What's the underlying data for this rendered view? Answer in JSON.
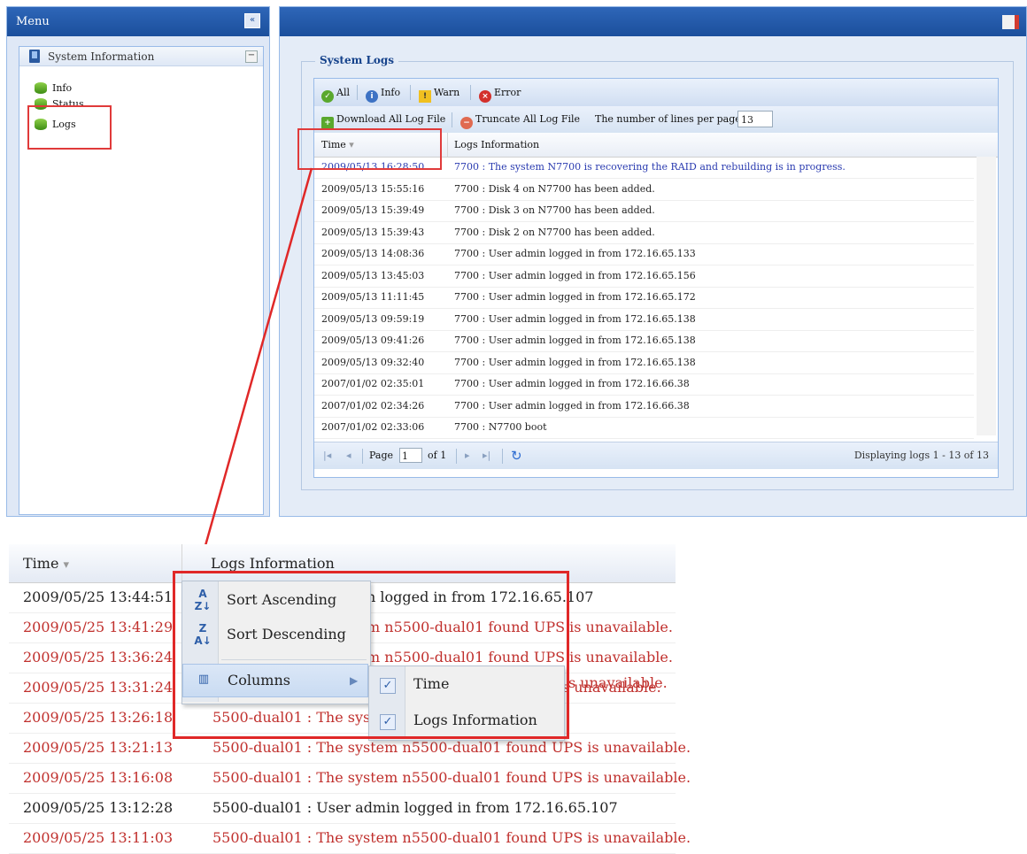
{
  "menu": {
    "title": "Menu",
    "collapse_icon": "«",
    "section": "System Information",
    "items": [
      "Info",
      "Status",
      "Logs"
    ]
  },
  "panel": {
    "legend": "System Logs",
    "filters": {
      "all": "All",
      "info": "Info",
      "warn": "Warn",
      "error": "Error"
    },
    "download": "Download All Log File",
    "truncate": "Truncate All Log File",
    "lines_label": "The number of lines per page",
    "lines_value": "13",
    "columns": {
      "time": "Time",
      "info": "Logs Information"
    },
    "rows": [
      {
        "time": "2009/05/13 16:28:50",
        "info": "7700 : The system N7700 is recovering the RAID and rebuilding is in progress."
      },
      {
        "time": "2009/05/13 15:55:16",
        "info": "7700 : Disk 4 on N7700 has been added."
      },
      {
        "time": "2009/05/13 15:39:49",
        "info": "7700 : Disk 3 on N7700 has been added."
      },
      {
        "time": "2009/05/13 15:39:43",
        "info": "7700 : Disk 2 on N7700 has been added."
      },
      {
        "time": "2009/05/13 14:08:36",
        "info": "7700 : User admin logged in from 172.16.65.133"
      },
      {
        "time": "2009/05/13 13:45:03",
        "info": "7700 : User admin logged in from 172.16.65.156"
      },
      {
        "time": "2009/05/13 11:11:45",
        "info": "7700 : User admin logged in from 172.16.65.172"
      },
      {
        "time": "2009/05/13 09:59:19",
        "info": "7700 : User admin logged in from 172.16.65.138"
      },
      {
        "time": "2009/05/13 09:41:26",
        "info": "7700 : User admin logged in from 172.16.65.138"
      },
      {
        "time": "2009/05/13 09:32:40",
        "info": "7700 : User admin logged in from 172.16.65.138"
      },
      {
        "time": "2007/01/02 02:35:01",
        "info": "7700 : User admin logged in from 172.16.66.38"
      },
      {
        "time": "2007/01/02 02:34:26",
        "info": "7700 : User admin logged in from 172.16.66.38"
      },
      {
        "time": "2007/01/02 02:33:06",
        "info": "7700 : N7700 boot"
      }
    ],
    "pager": {
      "page_label": "Page",
      "page_value": "1",
      "of_label": "of 1",
      "display": "Displaying logs 1 - 13 of 13"
    }
  },
  "zoom": {
    "columns": {
      "time": "Time",
      "info": "Logs Information"
    },
    "rows": [
      {
        "time": "2009/05/25 13:44:51",
        "info": "n logged in from 172.16.65.107",
        "level": "info"
      },
      {
        "time": "2009/05/25 13:41:29",
        "info": "m n5500-dual01 found UPS is unavailable.",
        "level": "error"
      },
      {
        "time": "2009/05/25 13:36:24",
        "info": "m n5500-dual01 found UPS is unavailable.",
        "level": "error"
      },
      {
        "time": "2009/05/25 13:31:24",
        "info": "s unavailable.",
        "level": "error"
      },
      {
        "time": "2009/05/25 13:26:18",
        "info": "5500-dual01 : The syste",
        "level": "error"
      },
      {
        "time": "2009/05/25 13:21:13",
        "info": "5500-dual01 : The system n5500-dual01 found UPS is unavailable.",
        "level": "error"
      },
      {
        "time": "2009/05/25 13:16:08",
        "info": "5500-dual01 : The system n5500-dual01 found UPS is unavailable.",
        "level": "error"
      },
      {
        "time": "2009/05/25 13:12:28",
        "info": "5500-dual01 : User admin logged in from 172.16.65.107",
        "level": "info"
      },
      {
        "time": "2009/05/25 13:11:03",
        "info": "5500-dual01 : The system n5500-dual01 found UPS is unavailable.",
        "level": "error"
      }
    ],
    "context_menu": {
      "sort_asc": "Sort Ascending",
      "sort_desc": "Sort Descending",
      "columns": "Columns",
      "col_time": "Time",
      "col_info": "Logs Information"
    },
    "error_text": "s unavailable."
  },
  "colors": {
    "header_blue": "#1b4f9c",
    "error_red": "#c0302d",
    "highlight_red": "#e02828"
  }
}
